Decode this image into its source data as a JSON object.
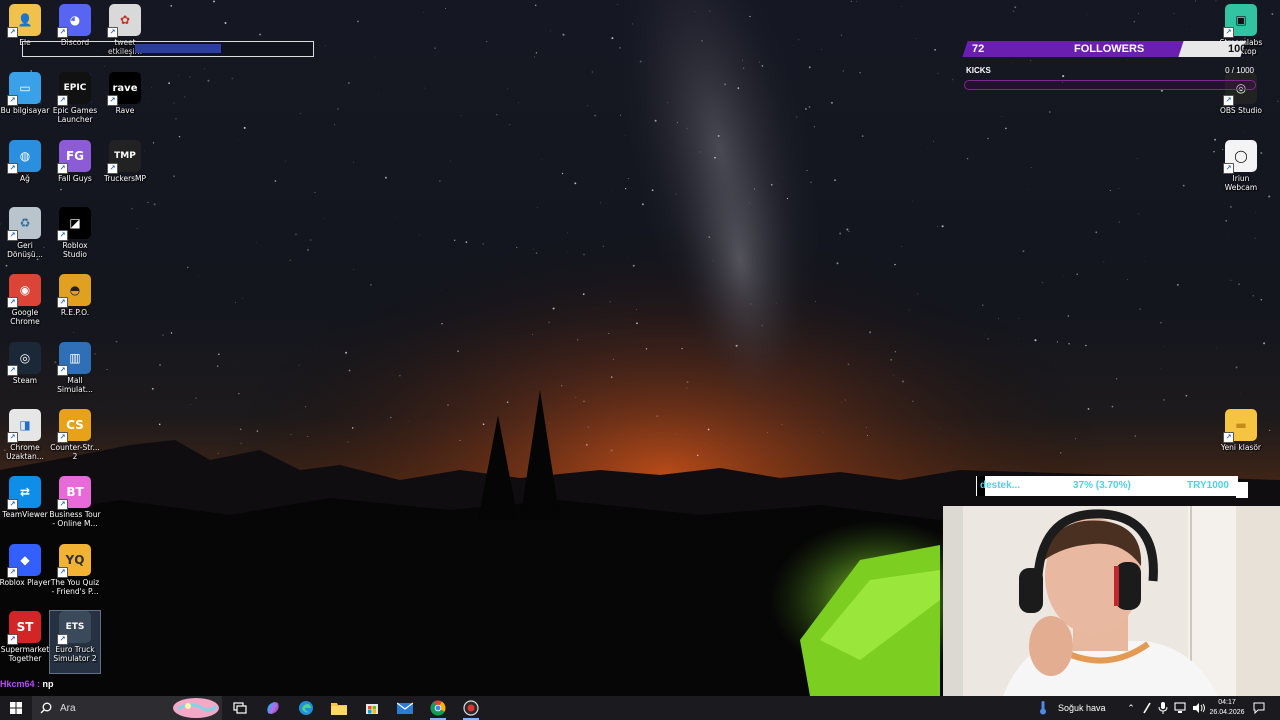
{
  "desktop": {
    "icons": [
      {
        "label": "Ele",
        "name": "desktop-icon-user-folder"
      },
      {
        "label": "Discord",
        "name": "desktop-icon-discord"
      },
      {
        "label": "tweet\netkileşim",
        "name": "desktop-icon-tweet-etkilesim"
      },
      {
        "label": "Bu bilgisayar",
        "name": "desktop-icon-this-pc"
      },
      {
        "label": "Epic Games\nLauncher",
        "name": "desktop-icon-epic-games"
      },
      {
        "label": "Rave",
        "name": "desktop-icon-rave"
      },
      {
        "label": "Ağ",
        "name": "desktop-icon-network"
      },
      {
        "label": "Fall Guys",
        "name": "desktop-icon-fall-guys"
      },
      {
        "label": "TruckersMP",
        "name": "desktop-icon-truckersmp"
      },
      {
        "label": "Geri\nDönüşü...",
        "name": "desktop-icon-recycle-bin"
      },
      {
        "label": "Roblox\nStudio",
        "name": "desktop-icon-roblox-studio"
      },
      {
        "label": "Google\nChrome",
        "name": "desktop-icon-google-chrome"
      },
      {
        "label": "R.E.P.O.",
        "name": "desktop-icon-repo"
      },
      {
        "label": "Steam",
        "name": "desktop-icon-steam"
      },
      {
        "label": "Mall\nSimulat...",
        "name": "desktop-icon-mall-simulator"
      },
      {
        "label": "Chrome\nUzaktan...",
        "name": "desktop-icon-chrome-remote"
      },
      {
        "label": "Counter-Str...\n2",
        "name": "desktop-icon-counter-strike-2"
      },
      {
        "label": "TeamViewer",
        "name": "desktop-icon-teamviewer"
      },
      {
        "label": "Business Tour\n- Online M...",
        "name": "desktop-icon-business-tour"
      },
      {
        "label": "Roblox Player",
        "name": "desktop-icon-roblox-player"
      },
      {
        "label": "The You Quiz\n- Friend's P...",
        "name": "desktop-icon-you-quiz"
      },
      {
        "label": "Supermarket\nTogether",
        "name": "desktop-icon-supermarket-together"
      },
      {
        "label": "Euro Truck\nSimulator 2",
        "name": "desktop-icon-euro-truck-simulator-2"
      },
      {
        "label": "Streamlabs\nDesktop",
        "name": "desktop-icon-streamlabs"
      },
      {
        "label": "OBS Studio",
        "name": "desktop-icon-obs-studio"
      },
      {
        "label": "Iriun\nWebcam",
        "name": "desktop-icon-iriun-webcam"
      },
      {
        "label": "Yeni klasör",
        "name": "desktop-icon-new-folder"
      }
    ]
  },
  "overlay": {
    "followers": {
      "current": "72",
      "title": "FOLLOWERS",
      "goal": "100",
      "progress": 0.72
    },
    "kicks": {
      "label": "KICKS",
      "value": "0 / 1000",
      "progress": 0.0
    },
    "donation": {
      "label": "destek...",
      "percent": "37% (3.70%)",
      "goal": "TRY1000"
    },
    "chat": {
      "user": "Hkcm64 :",
      "message": "np"
    }
  },
  "taskbar": {
    "search_placeholder": "Ara",
    "weather": "Soğuk hava",
    "time": "04:17",
    "date": "26.04.2026"
  },
  "colors": {
    "followers_purple": "#6a1fb0",
    "donation_cyan": "#4fd1e0",
    "taskbar": "#1b1b1f",
    "chat_user": "#b64cff"
  }
}
